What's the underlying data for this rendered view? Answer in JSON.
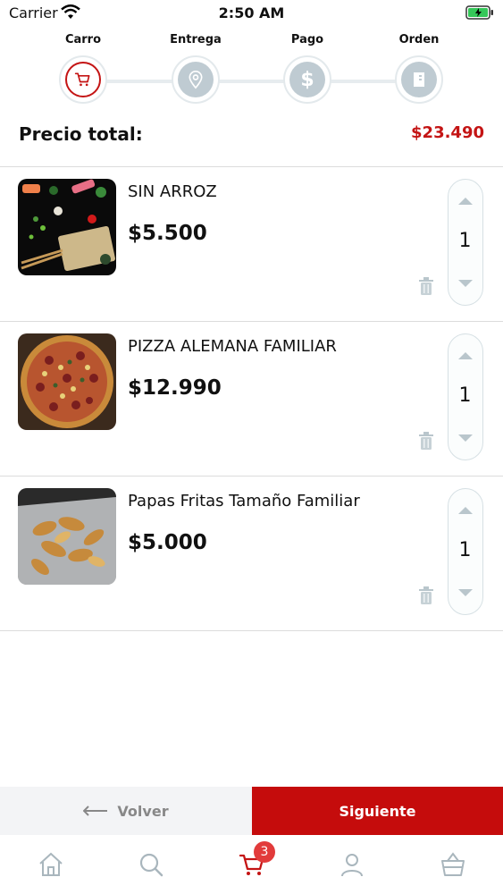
{
  "status": {
    "carrier": "Carrier",
    "time": "2:50 AM"
  },
  "steps": [
    {
      "label": "Carro",
      "icon": "cart-icon",
      "active": true
    },
    {
      "label": "Entrega",
      "icon": "location-pin-icon",
      "active": false
    },
    {
      "label": "Pago",
      "icon": "dollar-icon",
      "active": false
    },
    {
      "label": "Orden",
      "icon": "receipt-icon",
      "active": false
    }
  ],
  "total": {
    "label": "Precio total:",
    "value": "$23.490"
  },
  "items": [
    {
      "name": "SIN ARROZ",
      "price": "$5.500",
      "qty": "1"
    },
    {
      "name": "PIZZA ALEMANA FAMILIAR",
      "price": "$12.990",
      "qty": "1"
    },
    {
      "name": "Papas Fritas Tamaño Familiar",
      "price": "$5.000",
      "qty": "1"
    }
  ],
  "actions": {
    "back": "Volver",
    "next": "Siguiente"
  },
  "tabbar": {
    "items": [
      "home-icon",
      "search-icon",
      "cart-icon",
      "user-icon",
      "basket-icon"
    ],
    "cart_badge": "3"
  },
  "colors": {
    "accent": "#c41414",
    "step_inactive": "#bfcbd2",
    "button_next": "#c50c0c"
  }
}
